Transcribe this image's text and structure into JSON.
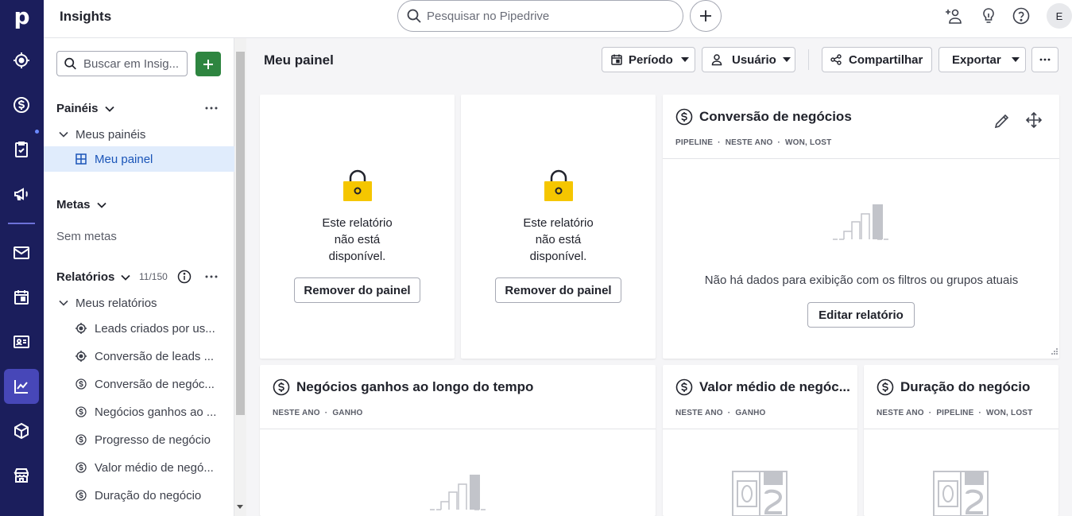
{
  "app": {
    "title": "Insights",
    "logo": "p"
  },
  "search": {
    "placeholder": "Pesquisar no Pipedrive"
  },
  "user": {
    "initial": "E"
  },
  "nav_rail": [
    "focus-icon",
    "deals-icon",
    "activities-icon",
    "campaigns-icon",
    "mail-icon",
    "calendar-icon",
    "contacts-icon",
    "insights-icon",
    "products-icon",
    "marketplace-icon"
  ],
  "sidebar": {
    "search_placeholder": "Buscar em Insig...",
    "dashboards": {
      "heading": "Painéis",
      "group": "Meus painéis",
      "items": [
        "Meu painel"
      ]
    },
    "goals": {
      "heading": "Metas",
      "empty": "Sem metas"
    },
    "reports": {
      "heading": "Relatórios",
      "count": "11/150",
      "group": "Meus relatórios",
      "items": [
        {
          "label": "Leads criados por us...",
          "icon": "target-icon"
        },
        {
          "label": "Conversão de leads ...",
          "icon": "target-icon"
        },
        {
          "label": "Conversão de negóc...",
          "icon": "dollar-icon"
        },
        {
          "label": "Negócios ganhos ao ...",
          "icon": "dollar-icon"
        },
        {
          "label": "Progresso de negócio",
          "icon": "dollar-icon"
        },
        {
          "label": "Valor médio de negó...",
          "icon": "dollar-icon"
        },
        {
          "label": "Duração do negócio",
          "icon": "dollar-icon"
        }
      ]
    }
  },
  "main": {
    "title": "Meu painel",
    "buttons": {
      "period": "Período",
      "user": "Usuário",
      "share": "Compartilhar",
      "export": "Exportar"
    }
  },
  "cards": {
    "unavailable_1": {
      "line1": "Este relatório",
      "line2": "não está",
      "line3": "disponível.",
      "button": "Remover do painel"
    },
    "unavailable_2": {
      "line1": "Este relatório",
      "line2": "não está",
      "line3": "disponível.",
      "button": "Remover do painel"
    },
    "conversion": {
      "title": "Conversão de negócios",
      "meta": [
        "PIPELINE",
        "NESTE ANO",
        "WON, LOST"
      ],
      "empty_text": "Não há dados para exibição com os filtros ou grupos atuais",
      "button": "Editar relatório"
    },
    "won_over_time": {
      "title": "Negócios ganhos ao longo do tempo",
      "meta": [
        "NESTE ANO",
        "GANHO"
      ]
    },
    "avg_value": {
      "title": "Valor médio de negóc...",
      "meta": [
        "NESTE ANO",
        "GANHO"
      ]
    },
    "duration": {
      "title": "Duração do negócio",
      "meta": [
        "NESTE ANO",
        "PIPELINE",
        "WON, LOST"
      ]
    }
  },
  "colors": {
    "rail": "#1b1e5c",
    "rail_active": "#4747b8",
    "accent_green": "#2e8540",
    "lock_yellow": "#f5c600",
    "selected_bg": "#e0ecfc"
  }
}
